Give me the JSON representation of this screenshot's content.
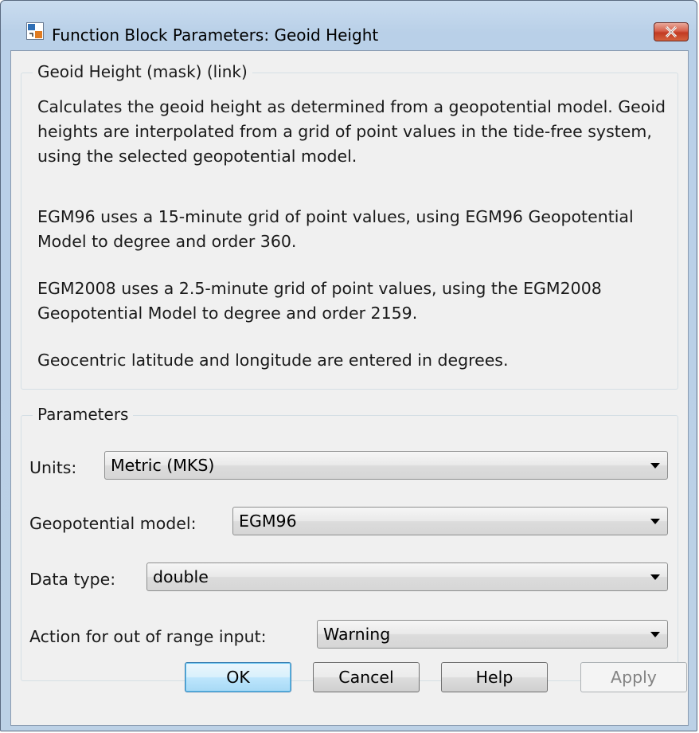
{
  "window": {
    "title": "Function Block Parameters: Geoid Height"
  },
  "description_group": {
    "legend": "Geoid Height (mask) (link)",
    "paragraphs": [
      "Calculates the geoid height as determined from a geopotential model. Geoid heights are interpolated from a grid of point values in the tide-free system, using the selected geopotential model.",
      "EGM96 uses a 15-minute grid of point values, using EGM96 Geopotential Model to degree and order 360.",
      "EGM2008 uses a 2.5-minute grid of point values, using the EGM2008 Geopotential Model to degree and order 2159.",
      "Geocentric latitude and longitude are entered in degrees."
    ]
  },
  "parameters_group": {
    "legend": "Parameters",
    "units": {
      "label": "Units:",
      "value": "Metric (MKS)"
    },
    "model": {
      "label": "Geopotential model:",
      "value": "EGM96"
    },
    "data_type": {
      "label": "Data type:",
      "value": "double"
    },
    "action": {
      "label": "Action for out of range input:",
      "value": "Warning"
    }
  },
  "buttons": {
    "ok": "OK",
    "cancel": "Cancel",
    "help": "Help",
    "apply": "Apply"
  },
  "icons": {
    "app": "simulink-block-icon",
    "close": "close-icon",
    "dropdown": "chevron-down-icon"
  },
  "colors": {
    "titlebar": "#bcd1e6",
    "close_button": "#c23a22",
    "dialog_face": "#f0f0f0",
    "default_button_border": "#3c7fb1"
  }
}
